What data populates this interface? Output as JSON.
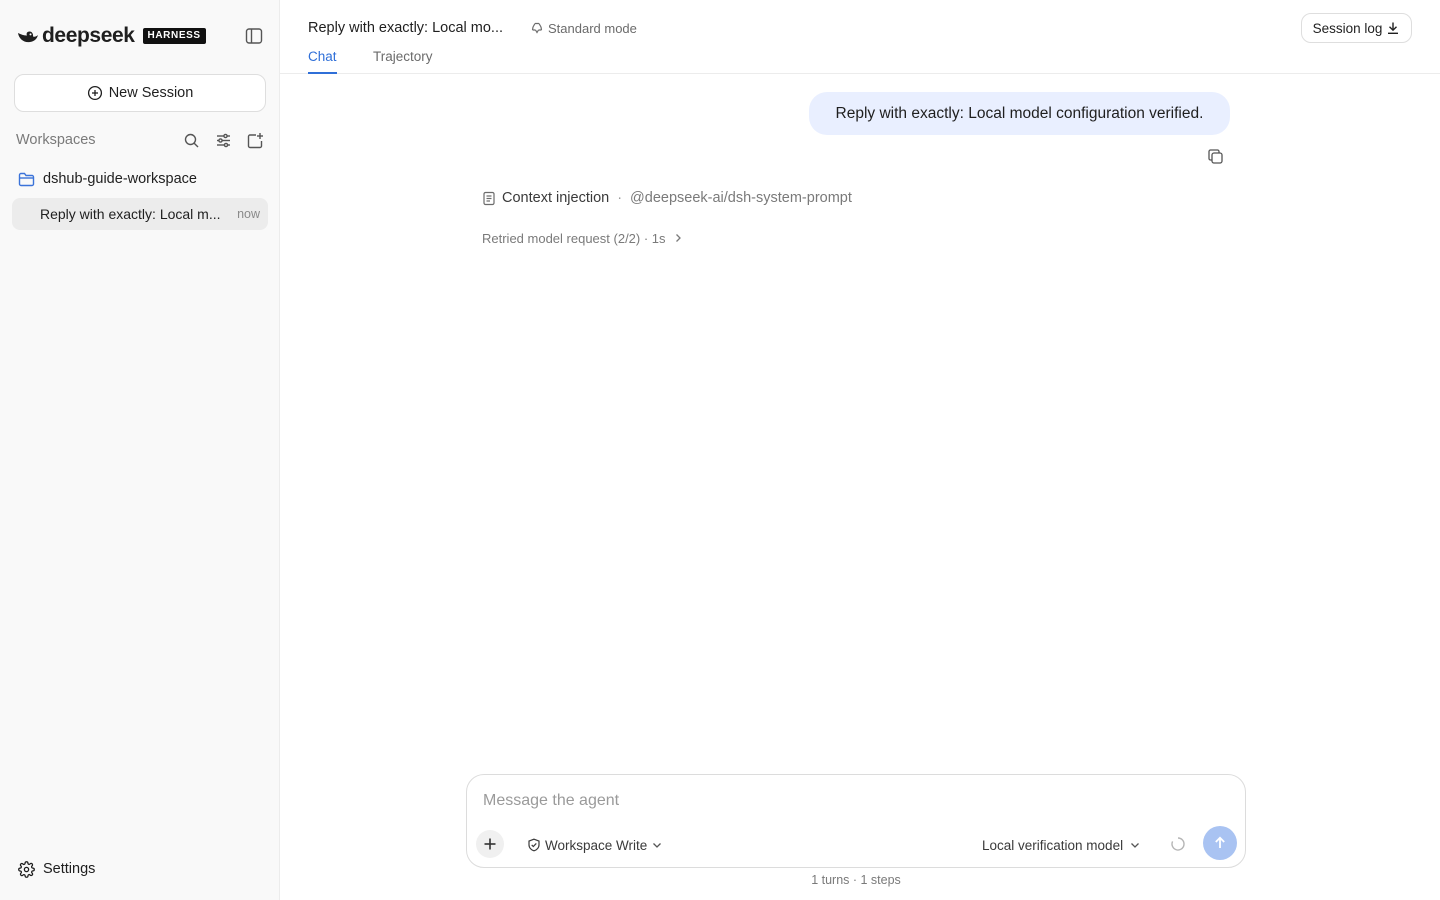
{
  "brand": {
    "wordmark": "deepseek",
    "badge": "HARNESS",
    "logo_icon": "whale-icon"
  },
  "sidebar": {
    "toggle_icon": "sidebar-panel-icon",
    "new_session_label": "New Session",
    "new_session_icon": "plus-circle-icon",
    "workspaces_label": "Workspaces",
    "workspace_tools": [
      "search-icon",
      "sliders-icon",
      "add-folder-icon"
    ],
    "workspace": {
      "name": "dshub-guide-workspace",
      "icon": "folder-icon",
      "icon_color": "#3b73d9"
    },
    "sessions": [
      {
        "title": "Reply with exactly: Local m...",
        "time": "now"
      }
    ],
    "settings_label": "Settings",
    "settings_icon": "gear-icon"
  },
  "header": {
    "title": "Reply with exactly: Local mo...",
    "mode_label": "Standard mode",
    "mode_icon": "recycle-icon",
    "tabs": [
      {
        "label": "Chat",
        "active": true
      },
      {
        "label": "Trajectory",
        "active": false
      }
    ],
    "session_log_label": "Session log",
    "session_log_icon": "download-icon"
  },
  "chat": {
    "user_message": "Reply with exactly: Local model configuration verified.",
    "copy_icon": "copy-icon",
    "context": {
      "label": "Context injection",
      "separator": "·",
      "ref": "@deepseek-ai/dsh-system-prompt",
      "icon": "document-icon"
    },
    "retry_text": "Retried model request (2/2) · 1s",
    "retry_icon": "chevron-right-icon"
  },
  "composer": {
    "placeholder": "Message the agent",
    "value": "",
    "attach_icon": "plus-icon",
    "permission_label": "Workspace Write",
    "permission_icon": "shield-check-icon",
    "model_label": "Local verification model",
    "status_icon": "spinner-icon",
    "send_icon": "arrow-up-icon",
    "send_color": "#a9c3f2"
  },
  "footer": {
    "stats": "1 turns · 1 steps"
  },
  "colors": {
    "accent": "#2f6fd8",
    "user_bubble": "#e9efff",
    "sidebar_bg": "#f9f9f9",
    "selected_item": "#ececec"
  }
}
